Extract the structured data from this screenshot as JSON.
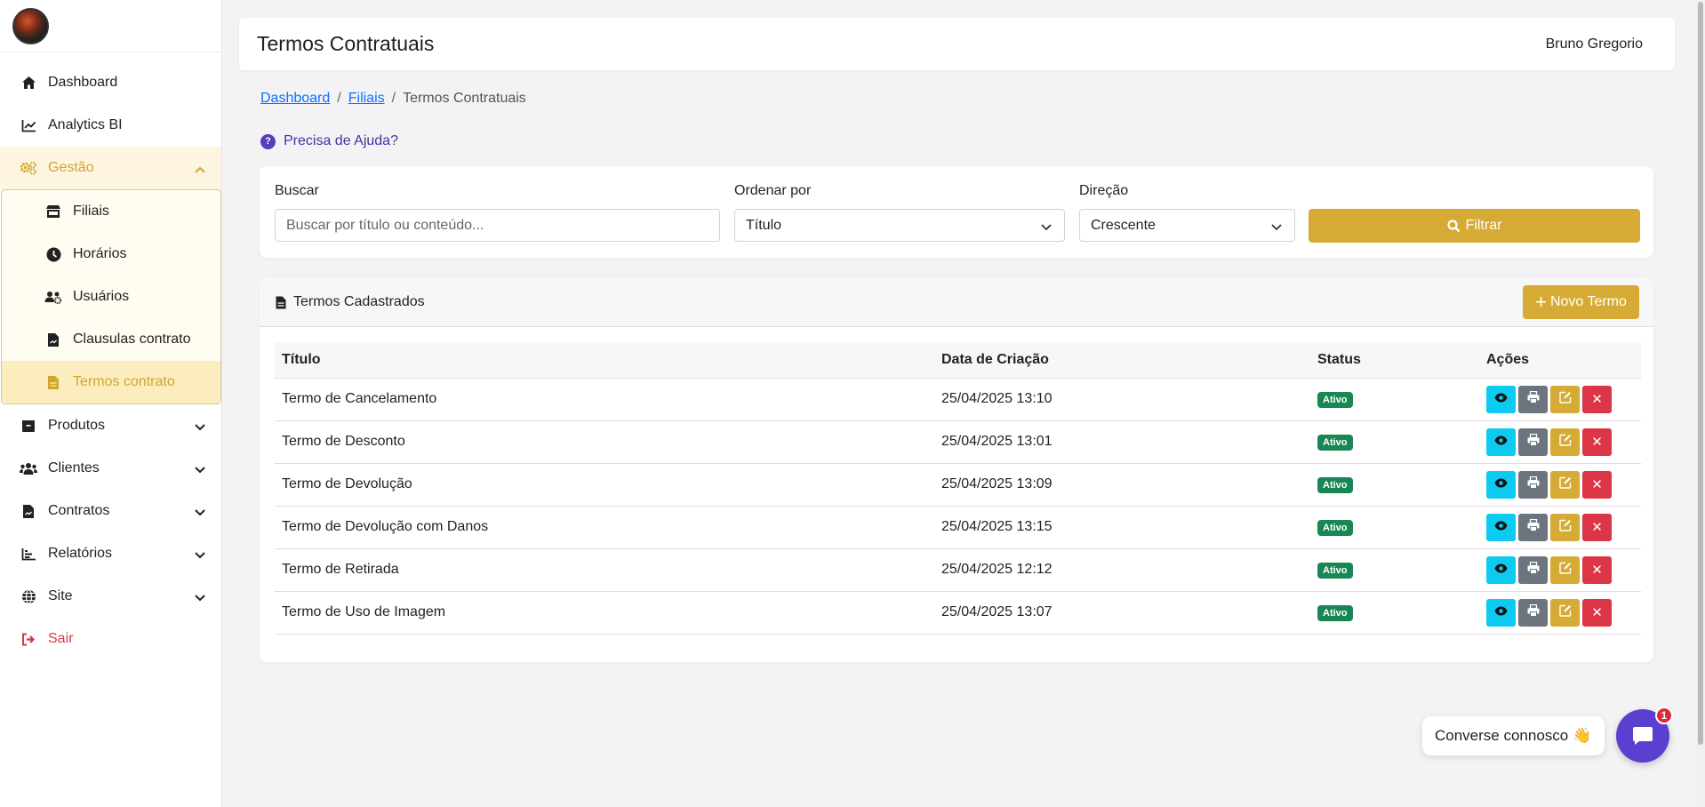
{
  "sidebar": {
    "items": [
      {
        "label": "Dashboard",
        "icon": "home-icon"
      },
      {
        "label": "Analytics BI",
        "icon": "chart-line-icon"
      },
      {
        "label": "Gestão",
        "icon": "gears-icon"
      },
      {
        "label": "Produtos",
        "icon": "box-icon"
      },
      {
        "label": "Clientes",
        "icon": "users-icon"
      },
      {
        "label": "Contratos",
        "icon": "file-contract-icon"
      },
      {
        "label": "Relatórios",
        "icon": "bar-chart-icon"
      },
      {
        "label": "Site",
        "icon": "globe-icon"
      },
      {
        "label": "Sair",
        "icon": "sign-out-icon"
      }
    ],
    "submenu": [
      {
        "label": "Filiais",
        "icon": "store-icon"
      },
      {
        "label": "Horários",
        "icon": "clock-icon"
      },
      {
        "label": "Usuários",
        "icon": "users-gear-icon"
      },
      {
        "label": "Clausulas contrato",
        "icon": "file-icon"
      },
      {
        "label": "Termos contrato",
        "icon": "file-text-icon"
      }
    ]
  },
  "header": {
    "title": "Termos Contratuais",
    "user": "Bruno Gregorio"
  },
  "breadcrumb": {
    "items": [
      "Dashboard",
      "Filiais",
      "Termos Contratuais"
    ],
    "separator": "/"
  },
  "help": {
    "label": "Precisa de Ajuda?"
  },
  "filters": {
    "search_label": "Buscar",
    "search_placeholder": "Buscar por título ou conteúdo...",
    "order_label": "Ordenar por",
    "order_value": "Título",
    "direction_label": "Direção",
    "direction_value": "Crescente",
    "filter_button": "Filtrar"
  },
  "terms": {
    "card_title": "Termos Cadastrados",
    "new_button": "Novo Termo",
    "columns": [
      "Título",
      "Data de Criação",
      "Status",
      "Ações"
    ],
    "rows": [
      {
        "title": "Termo de Cancelamento",
        "created": "25/04/2025 13:10",
        "status": "Ativo"
      },
      {
        "title": "Termo de Desconto",
        "created": "25/04/2025 13:01",
        "status": "Ativo"
      },
      {
        "title": "Termo de Devolução",
        "created": "25/04/2025 13:09",
        "status": "Ativo"
      },
      {
        "title": "Termo de Devolução com Danos",
        "created": "25/04/2025 13:15",
        "status": "Ativo"
      },
      {
        "title": "Termo de Retirada",
        "created": "25/04/2025 12:12",
        "status": "Ativo"
      },
      {
        "title": "Termo de Uso de Imagem",
        "created": "25/04/2025 13:07",
        "status": "Ativo"
      }
    ]
  },
  "chat": {
    "label": "Converse connosco 👋",
    "unread": "1"
  },
  "colors": {
    "accent": "#d5ab35",
    "active_text": "#d4a52c",
    "status_active": "#198754",
    "view": "#0dcaf0",
    "print": "#6c757d",
    "delete": "#dc3545",
    "chat": "#5b3fd0"
  }
}
